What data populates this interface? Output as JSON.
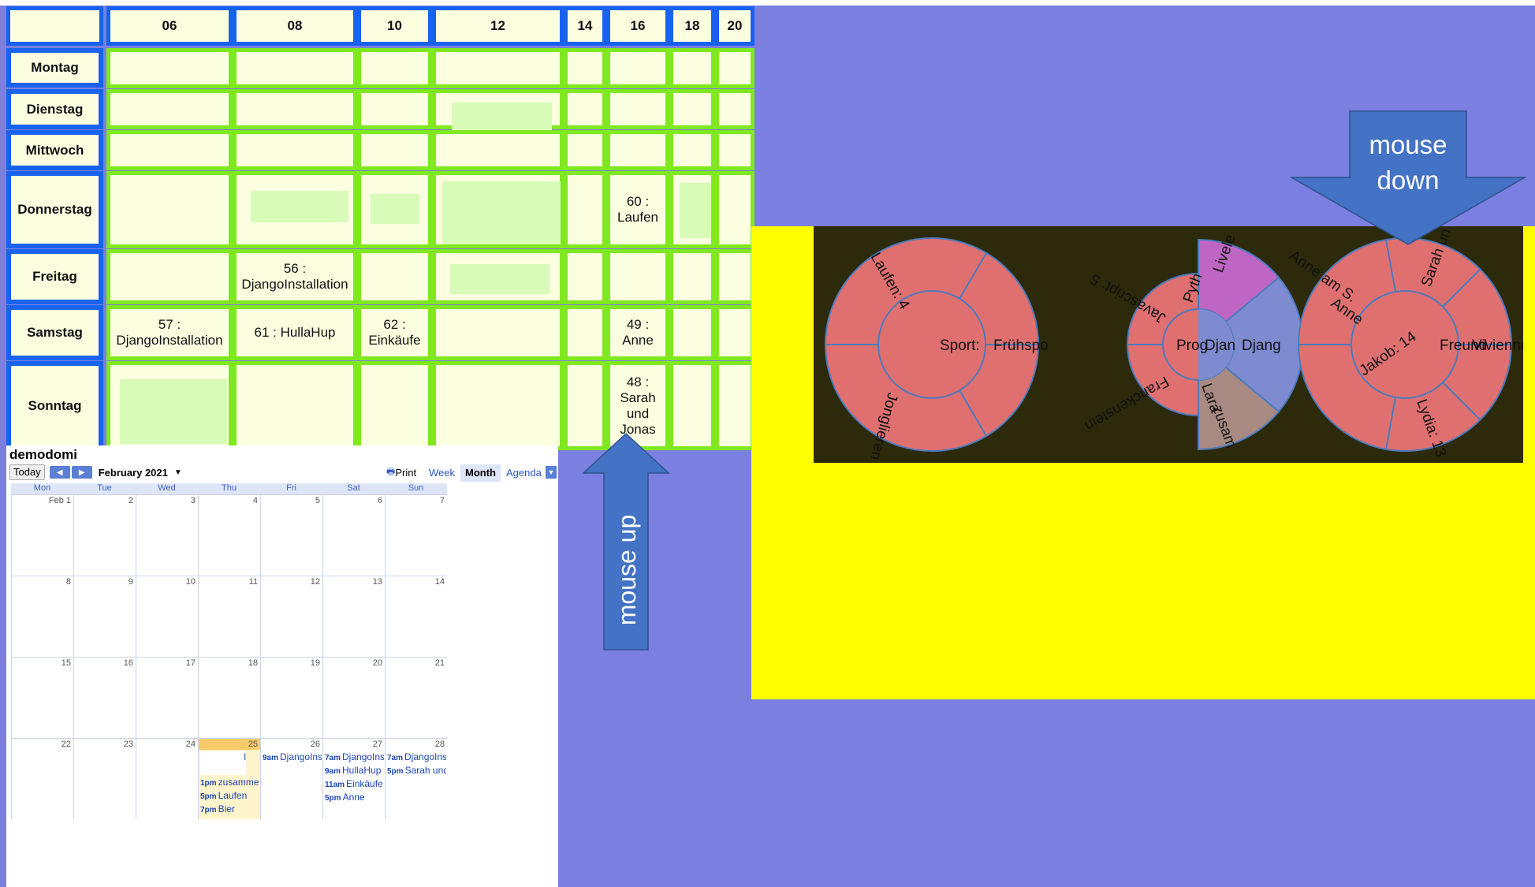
{
  "schedule": {
    "hours": [
      "06",
      "08",
      "10",
      "12",
      "14",
      "16",
      "18",
      "20"
    ],
    "days": [
      "Montag",
      "Dienstag",
      "Mittwoch",
      "Donnerstag",
      "Freitag",
      "Samstag",
      "Sonntag"
    ],
    "events": {
      "don_16": "60 : Laufen",
      "fre_08": "56 : DjangoInstallation",
      "sam_06": "57 : DjangoInstallation",
      "sam_08": "61 : HullaHup",
      "sam_10": "62 : Einkäufe",
      "sam_16": "49 : Anne",
      "son_16": "48 : Sarah und Jonas"
    }
  },
  "calendar": {
    "title": "demodomi",
    "today_label": "Today",
    "month_label": "February 2021",
    "print_label": "Print",
    "views": [
      "Week",
      "Month",
      "Agenda"
    ],
    "weekdays": [
      "Mon",
      "Tue",
      "Wed",
      "Thu",
      "Fri",
      "Sat",
      "Sun"
    ],
    "weeks": [
      [
        "Feb 1",
        "2",
        "3",
        "4",
        "5",
        "6",
        "7"
      ],
      [
        "8",
        "9",
        "10",
        "11",
        "12",
        "13",
        "14"
      ],
      [
        "15",
        "16",
        "17",
        "18",
        "19",
        "20",
        "21"
      ],
      [
        "22",
        "23",
        "24",
        "25",
        "26",
        "27",
        "28"
      ]
    ],
    "events": {
      "thu25": [
        [
          "",
          "l"
        ],
        [
          "1pm",
          "zusammenf"
        ],
        [
          "5pm",
          "Laufen"
        ],
        [
          "7pm",
          "Bier"
        ]
      ],
      "fri26": [
        [
          "9am",
          "DjangoInsta"
        ]
      ],
      "sat27": [
        [
          "7am",
          "DjangoInsta"
        ],
        [
          "9am",
          "HullaHup"
        ],
        [
          "11am",
          "Einkäufe"
        ],
        [
          "5pm",
          "Anne"
        ]
      ],
      "sun28": [
        [
          "7am",
          "DjangoInsta"
        ],
        [
          "5pm",
          "Sarah und J"
        ]
      ]
    }
  },
  "annotations": {
    "mouse_up": "mouse up",
    "mouse_down_1": "mouse",
    "mouse_down_2": "down"
  },
  "sunbursts": {
    "left": {
      "center": "Sport:",
      "right": "Frühspo",
      "top": "Laufen: 4",
      "bottom": "Jonglieren"
    },
    "middle": {
      "center": "Prog",
      "seg_a": "Djan",
      "seg_b": "Djang",
      "pyth": "Pyth",
      "live": "Livele",
      "js": "Javascript: 5",
      "franck": "Franckenstein",
      "lara": "Lara",
      "zus": "zusam"
    },
    "right": {
      "center": "Freund",
      "right": "Vivienne",
      "sarah": "Sarah un",
      "anne": "Anne",
      "annes": "Anne am S.",
      "jakob": "Jakob: 14",
      "lydia": "Lydia: 13"
    }
  },
  "colors": {
    "accent_blue": "#1763f0",
    "cell_border": "#7fe81e",
    "background": "#7b7fdf",
    "arrow": "#4472c4",
    "sunburst": "#e07070"
  }
}
